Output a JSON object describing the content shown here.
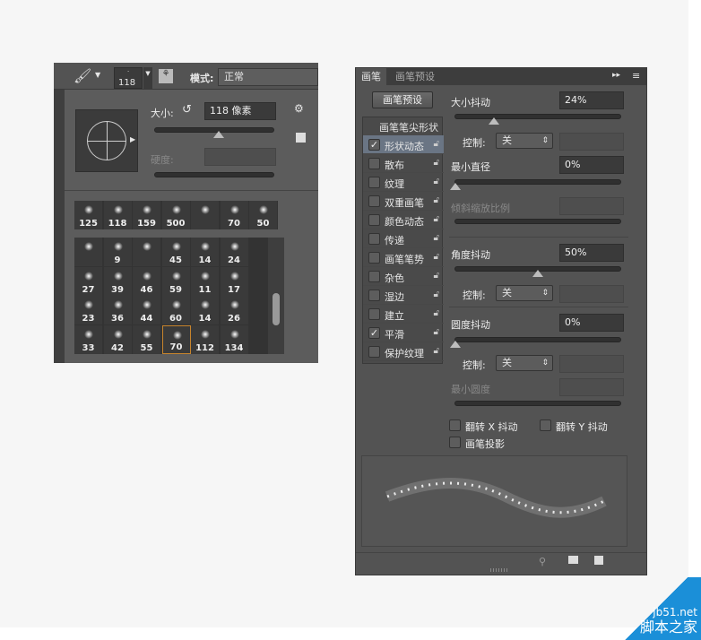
{
  "options_bar": {
    "brush_size_preview": "118",
    "mode_label": "模式:",
    "mode_value": "正常"
  },
  "brush_popup": {
    "size_label": "大小:",
    "size_value": "118 像素",
    "hardness_label": "硬度:",
    "size_slider_fraction": 0.36,
    "recent_brushes": [
      "125",
      "118",
      "159",
      "500",
      "",
      "70",
      "50"
    ],
    "brush_grid": [
      [
        "",
        "9",
        "",
        "45",
        "14",
        "24"
      ],
      [
        "27",
        "39",
        "46",
        "59",
        "11",
        "17"
      ],
      [
        "23",
        "36",
        "44",
        "60",
        "14",
        "26"
      ],
      [
        "33",
        "42",
        "55",
        "70",
        "112",
        "134"
      ]
    ],
    "selected": "70"
  },
  "brush_panel": {
    "tabs": [
      "画笔",
      "画笔预设"
    ],
    "preset_button": "画笔预设",
    "tip_shape_header": "画笔笔尖形状",
    "list": [
      {
        "label": "形状动态",
        "checked": true,
        "active": true
      },
      {
        "label": "散布",
        "checked": false
      },
      {
        "label": "纹理",
        "checked": false
      },
      {
        "label": "双重画笔",
        "checked": false
      },
      {
        "label": "颜色动态",
        "checked": false
      },
      {
        "label": "传递",
        "checked": false
      },
      {
        "label": "画笔笔势",
        "checked": false
      },
      {
        "label": "杂色",
        "checked": false
      },
      {
        "label": "湿边",
        "checked": false
      },
      {
        "label": "建立",
        "checked": false
      },
      {
        "label": "平滑",
        "checked": true
      },
      {
        "label": "保护纹理",
        "checked": false
      }
    ],
    "size_jitter": {
      "label": "大小抖动",
      "value": "24%",
      "fraction": 0.24
    },
    "control1": {
      "label": "控制:",
      "value": "关"
    },
    "min_diameter": {
      "label": "最小直径",
      "value": "0%",
      "fraction": 0
    },
    "tilt_scale": {
      "label": "倾斜缩放比例"
    },
    "angle_jitter": {
      "label": "角度抖动",
      "value": "50%",
      "fraction": 0.5
    },
    "control2": {
      "label": "控制:",
      "value": "关"
    },
    "roundness_jitter": {
      "label": "圆度抖动",
      "value": "0%",
      "fraction": 0
    },
    "control3": {
      "label": "控制:",
      "value": "关"
    },
    "min_roundness": {
      "label": "最小圆度"
    },
    "flip_x": "翻转 X 抖动",
    "flip_y": "翻转 Y 抖动",
    "brush_projection": "画笔投影"
  },
  "watermark": {
    "site": "jb51.net",
    "name": "脚本之家"
  }
}
